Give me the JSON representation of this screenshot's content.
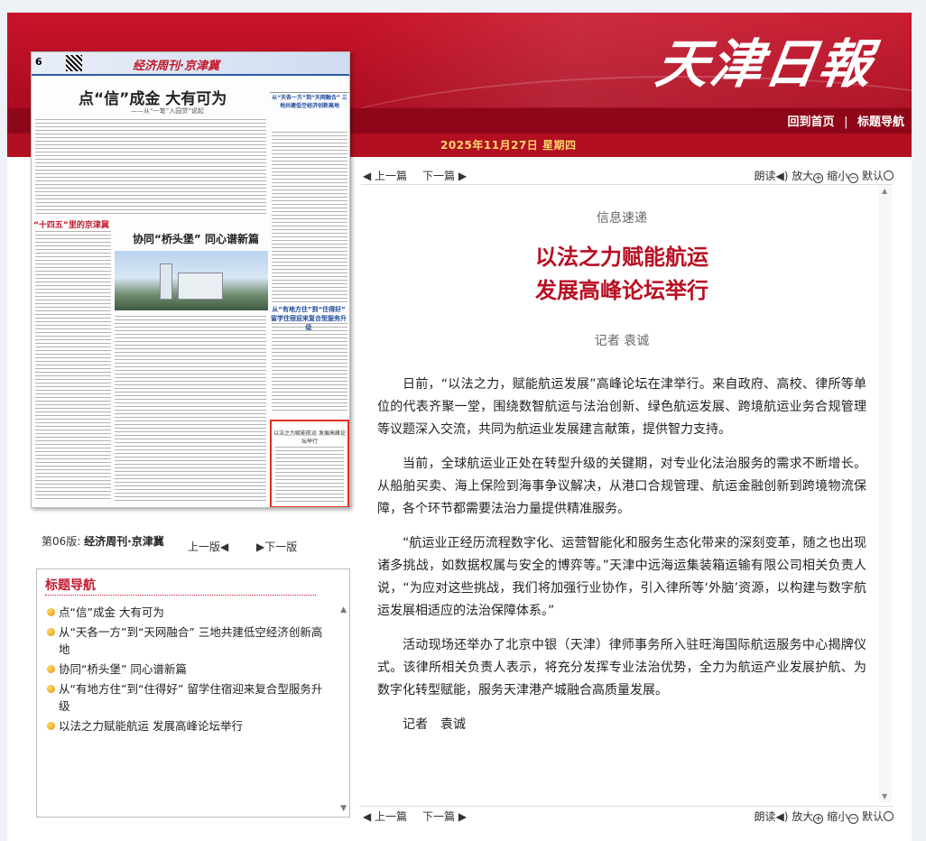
{
  "header": {
    "logo": "天津日報",
    "nav_home": "回到首页",
    "nav_sep": "|",
    "nav_titles": "标题导航",
    "date": "2025年11月27日 星期四"
  },
  "thumbnail": {
    "page_num": "6",
    "section_title": "经济周刊·京津冀",
    "headline1": "点“信”成金  大有可为",
    "headline1_sub": "——从“一笔”入园贷”说起",
    "side_head": "从“天各一方”到“天网融合” 三地共建低空经济创新高地",
    "band": "“十四五”里的京津冀",
    "headline2": "协同“桥头堡” 同心谱新篇",
    "headline3": "从“有地方住”到“住得好” 留学住宿迎来复合型服务升级",
    "highlight_box": "以法之力赋能航运 发展高峰论坛举行"
  },
  "edition": {
    "label": "第06版:",
    "name": "经济周刊·京津冀",
    "prev": "上一版◀",
    "next": "▶下一版"
  },
  "title_nav": {
    "heading": "标题导航",
    "items": [
      "点“信”成金 大有可为",
      "从“天各一方”到“天网融合” 三地共建低空经济创新高地",
      "协同“桥头堡” 同心谱新篇",
      "从“有地方住”到“住得好” 留学住宿迎来复合型服务升级",
      "以法之力赋能航运 发展高峰论坛举行"
    ]
  },
  "pager": {
    "prev": "◀ 上一篇",
    "next": "下一篇 ▶",
    "read": "朗读",
    "zoom_in": "放大",
    "zoom_out": "缩小",
    "reset": "默认"
  },
  "article": {
    "column": "信息速递",
    "title_line1": "以法之力赋能航运",
    "title_line2": "发展高峰论坛举行",
    "author": "记者 袁诚",
    "paragraphs": [
      "日前，“以法之力，赋能航运发展”高峰论坛在津举行。来自政府、高校、律所等单位的代表齐聚一堂，围绕数智航运与法治创新、绿色航运发展、跨境航运业务合规管理等议题深入交流，共同为航运业发展建言献策，提供智力支持。",
      "当前，全球航运业正处在转型升级的关键期，对专业化法治服务的需求不断增长。从船舶买卖、海上保险到海事争议解决，从港口合规管理、航运金融创新到跨境物流保障，各个环节都需要法治力量提供精准服务。",
      "“航运业正经历流程数字化、运营智能化和服务生态化带来的深刻变革，随之也出现诸多挑战，如数据权属与安全的博弈等。”天津中远海运集装箱运输有限公司相关负责人说，“为应对这些挑战，我们将加强行业协作，引入律所等‘外脑’资源，以构建与数字航运发展相适应的法治保障体系。”",
      "活动现场还举办了北京中银（天津）律师事务所入驻旺海国际航运服务中心揭牌仪式。该律所相关负责人表示，将充分发挥专业法治优势，全力为航运产业发展护航、为数字化转型赋能，服务天津港产城融合高质量发展。"
    ],
    "signature": "记者　袁诚"
  }
}
